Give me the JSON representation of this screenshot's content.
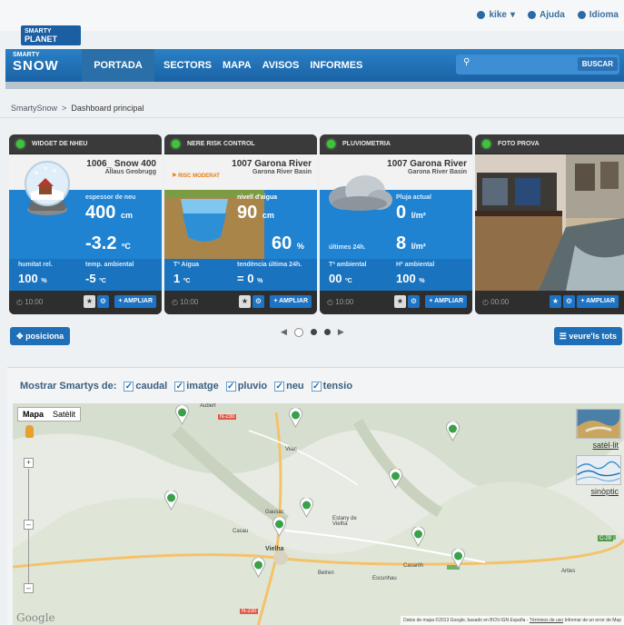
{
  "user_bar": {
    "user": "kike",
    "help": "Ajuda",
    "language": "Idioma"
  },
  "logo": {
    "line1": "SMARTY",
    "line2": "PLANET"
  },
  "nav": {
    "brand_small": "SMARTY",
    "brand_big": "SNOW",
    "active": "PORTADA",
    "items": [
      "SECTORS",
      "MAPA",
      "AVISOS",
      "INFORMES"
    ],
    "search_button": "BUSCAR"
  },
  "breadcrumb": {
    "root": "SmartySnow",
    "separator": ">",
    "current": "Dashboard principal"
  },
  "widgets": [
    {
      "title": "WIDGET DE NHEU",
      "name": "1006_ Snow 400",
      "subtitle": "Allaus Geobrugg",
      "label_main": "espessor de neu",
      "value_main": "400",
      "unit_main": "cm",
      "value_second": "-3.2",
      "unit_second": "ºC",
      "foot_label_1": "humitat rel.",
      "foot_value_1": "100",
      "foot_unit_1": "%",
      "foot_label_2": "temp. ambiental",
      "foot_value_2": "-5",
      "foot_unit_2": "ºC",
      "time": "10:00",
      "ampliar": "AMPLIAR"
    },
    {
      "title": "NERE RISK CONTROL",
      "name": "1007 Garona River",
      "subtitle": "Garona River Basin",
      "risk": "RISC MODERAT",
      "label_main": "nivell d'aigua",
      "value_main": "90",
      "unit_main": "cm",
      "value_second": "60",
      "unit_second": "%",
      "foot_label_1": "Tª Aigua",
      "foot_value_1": "1",
      "foot_unit_1": "ºC",
      "foot_label_2": "tendència última 24h.",
      "foot_value_2": "= 0",
      "foot_unit_2": "%",
      "time": "10:00",
      "ampliar": "AMPLIAR"
    },
    {
      "title": "PLUVIOMETRIA",
      "name": "1007 Garona River",
      "subtitle": "Garona River Basin",
      "label_main": "Pluja actual",
      "value_main": "0",
      "unit_main": "l/m²",
      "label_second": "últimes 24h.",
      "value_second": "8",
      "unit_second": "l/m²",
      "foot_label_1": "Tª ambiental",
      "foot_value_1": "00",
      "foot_unit_1": "ºC",
      "foot_label_2": "Hª ambiental",
      "foot_value_2": "100",
      "foot_unit_2": "%",
      "time": "10:00",
      "ampliar": "AMPLIAR"
    },
    {
      "title": "FOTO PROVA",
      "time": "00:00",
      "ampliar": "AMPLIAR"
    }
  ],
  "controls": {
    "posiciona": "posiciona",
    "veure_tots": "veure'ls tots"
  },
  "map_panel": {
    "filter_label": "Mostrar Smartys de:",
    "filters": [
      "caudal",
      "imatge",
      "pluvio",
      "neu",
      "tensio"
    ],
    "map_types": [
      "Mapa",
      "Satèlit"
    ],
    "side_views": [
      "satèl·lit",
      "sinòptic"
    ],
    "places": [
      "Aubert",
      "Vilac",
      "Gausac",
      "Casau",
      "Vielha",
      "Estany de Vielha",
      "Betren",
      "Escunhau",
      "Casarilh",
      "Arties"
    ],
    "roads": [
      "N-230",
      "C-28"
    ],
    "google": "Google",
    "attribution": "Datos de mapa ©2013 Google, basado en BCN IGN España -",
    "terms": "Términos de uso",
    "report": "Informar de un error de Map"
  },
  "colors": {
    "nav_blue": "#1d6fb5",
    "widget_blue": "#1f83d2",
    "widget_dark": "#2f2f2f",
    "status_green": "#3ec43a",
    "pin_green": "#3aa04a"
  },
  "icons": [
    "user-icon",
    "help-icon",
    "flag-icon",
    "search-icon",
    "clock-icon",
    "star-icon",
    "gear-icon",
    "plus-icon",
    "move-icon",
    "list-icon",
    "pegman-icon",
    "map-pin-icon"
  ]
}
